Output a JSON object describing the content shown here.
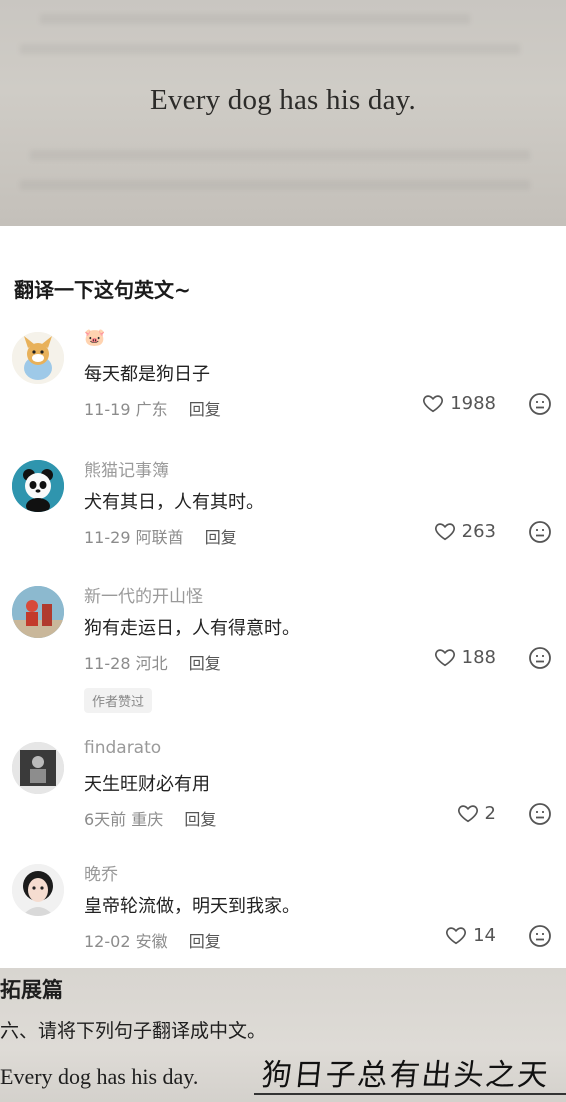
{
  "top_photo": {
    "quote": "Every dog has his day."
  },
  "post": {
    "title": "翻译一下这句英文~"
  },
  "comments": [
    {
      "username": "🐷",
      "content": "每天都是狗日子",
      "date": "11-19",
      "location": "广东",
      "reply_label": "回复",
      "likes": "1988",
      "avatar_icon": "cartoon-dog-avatar"
    },
    {
      "username": "熊猫记事簿",
      "content": "犬有其日，人有其时。",
      "date": "11-29",
      "location": "阿联酋",
      "reply_label": "回复",
      "likes": "263",
      "avatar_icon": "panda-avatar"
    },
    {
      "username": "新一代的开山怪",
      "content": "狗有走运日，人有得意时。",
      "date": "11-28",
      "location": "河北",
      "reply_label": "回复",
      "likes": "188",
      "avatar_icon": "figure-avatar",
      "badge": "作者赞过"
    },
    {
      "username": "findarato",
      "content": "天生旺财必有用",
      "date": "6天前",
      "location": "重庆",
      "reply_label": "回复",
      "likes": "2",
      "avatar_icon": "photo-avatar"
    },
    {
      "username": "晚乔",
      "content": "皇帝轮流做，明天到我家。",
      "date": "12-02",
      "location": "安徽",
      "reply_label": "回复",
      "likes": "14",
      "avatar_icon": "girl-avatar"
    }
  ],
  "bottom_photo": {
    "section_title": "拓展篇",
    "instruction": "六、请将下列句子翻译成中文。",
    "sentence": "Every dog has his day.",
    "handwritten_answer": "狗日子总有出头之天"
  },
  "colors": {
    "accent_text": "#222222",
    "muted_text": "#8c8c8c",
    "username_text": "#9a9a9a"
  }
}
